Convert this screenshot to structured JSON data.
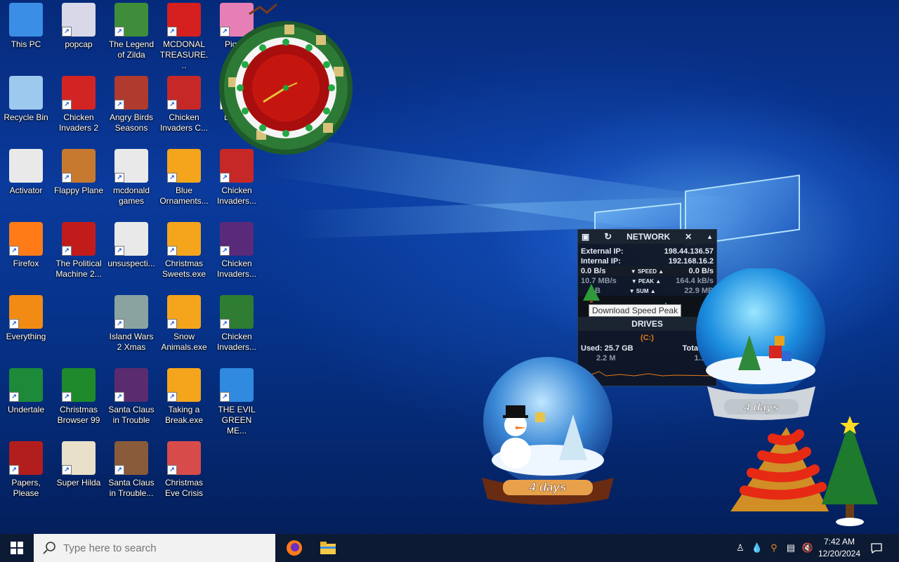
{
  "desktop": {
    "icons": [
      {
        "label": "This PC",
        "icon": "this-pc-icon",
        "color": "#3a8ee6"
      },
      {
        "label": "Recycle Bin",
        "icon": "recycle-bin-icon",
        "color": "#9ec9ef"
      },
      {
        "label": "Activator",
        "icon": "folder-icon",
        "color": "#e9e9e9"
      },
      {
        "label": "Firefox",
        "icon": "firefox-icon",
        "color": "#ff7b18"
      },
      {
        "label": "Everything",
        "icon": "search-magnifier-icon",
        "color": "#f28b13"
      },
      {
        "label": "Undertale",
        "icon": "undertale-icon",
        "color": "#1d8a3a"
      },
      {
        "label": "Papers, Please",
        "icon": "papers-please-icon",
        "color": "#b21d1d"
      },
      {
        "label": "popcap",
        "icon": "popcap-file-icon",
        "color": "#d8d8e8"
      },
      {
        "label": "Chicken Invaders 2",
        "icon": "chicken-invaders-2-icon",
        "color": "#d32424"
      },
      {
        "label": "Flappy Plane",
        "icon": "flappy-plane-icon",
        "color": "#c7792f"
      },
      {
        "label": "The Political Machine 2...",
        "icon": "political-machine-icon",
        "color": "#c21b1b"
      },
      {
        "label": "Christmas Browser 99",
        "icon": "christmas-tree-icon",
        "color": "#1f8a2c"
      },
      {
        "label": "Super Hilda",
        "icon": "super-hilda-icon",
        "color": "#e8e0c8"
      },
      {
        "label": "The Legend of Zilda",
        "icon": "legend-of-zilda-icon",
        "color": "#3f8c3b"
      },
      {
        "label": "Angry Birds Seasons",
        "icon": "angry-birds-icon",
        "color": "#b03a2e"
      },
      {
        "label": "mcdonald games",
        "icon": "folder-icon",
        "color": "#e9e9e9"
      },
      {
        "label": "unsuspecti...",
        "icon": "folder-icon",
        "color": "#e9e9e9"
      },
      {
        "label": "Island Wars 2 Xmas",
        "icon": "island-wars-icon",
        "color": "#8aa3a0"
      },
      {
        "label": "Santa Claus in Trouble",
        "icon": "santa-claus-icon",
        "color": "#5b2b6f"
      },
      {
        "label": "Santa Claus in Trouble...",
        "icon": "santa-claus-icon",
        "color": "#8a5b3a"
      },
      {
        "label": "MCDONAL TREASURE...",
        "icon": "mcdonalds-icon",
        "color": "#d61f1f"
      },
      {
        "label": "Chicken Invaders C...",
        "icon": "chicken-invaders-icon",
        "color": "#c62828"
      },
      {
        "label": "Blue Ornaments...",
        "icon": "installer-exe-icon",
        "color": "#f4a51c"
      },
      {
        "label": "Christmas Sweets.exe",
        "icon": "installer-exe-icon",
        "color": "#f4a51c"
      },
      {
        "label": "Snow Animals.exe",
        "icon": "installer-exe-icon",
        "color": "#f4a51c"
      },
      {
        "label": "Taking a Break.exe",
        "icon": "installer-exe-icon",
        "color": "#f4a51c"
      },
      {
        "label": "Christmas Eve Crisis",
        "icon": "santa-face-icon",
        "color": "#d84b4b"
      },
      {
        "label": "Pigg...",
        "icon": "piggly-icon",
        "color": "#e57fb5"
      },
      {
        "label": "Loco...",
        "icon": "loco-icon",
        "color": "#3b6bbf"
      },
      {
        "label": "Chicken Invaders...",
        "icon": "chicken-invaders-icon",
        "color": "#c62828"
      },
      {
        "label": "Chicken Invaders...",
        "icon": "chicken-invaders-icon",
        "color": "#5a2a7a"
      },
      {
        "label": "Chicken Invaders...",
        "icon": "chicken-invaders-icon",
        "color": "#2e7d32"
      },
      {
        "label": "THE EVIL GREEN ME...",
        "icon": "messenger-icon",
        "color": "#2f8ae0"
      }
    ]
  },
  "network_gadget": {
    "title": "NETWORK",
    "external_ip_label": "External IP:",
    "external_ip": "198.44.136.57",
    "internal_ip_label": "Internal IP:",
    "internal_ip": "192.168.16.2",
    "speed_left": "0.0 B/s",
    "speed_label": "SPEED",
    "speed_right": "0.0 B/s",
    "peak_left": "10.7 MB/s",
    "peak_label": "PEAK",
    "peak_right": "164.4 kB/s",
    "sum_left": "B",
    "sum_label": "SUM",
    "sum_right": "22.9 MB",
    "tooltip": "Download Speed Peak",
    "drives_title": "DRIVES",
    "drive_letter": "(C:)",
    "used_label": "Used: 25.7 GB",
    "total_label": "Total: 99",
    "read_rate": "2.2 M",
    "write_rate": "1.1 M"
  },
  "snow_globes": {
    "left_label": "4 days",
    "right_label": "4 days"
  },
  "taskbar": {
    "search_placeholder": "Type here to search",
    "time": "7:42 AM",
    "date": "12/20/2024"
  },
  "colors": {
    "taskbar": "#0c1a33",
    "accent": "#0078d7"
  }
}
